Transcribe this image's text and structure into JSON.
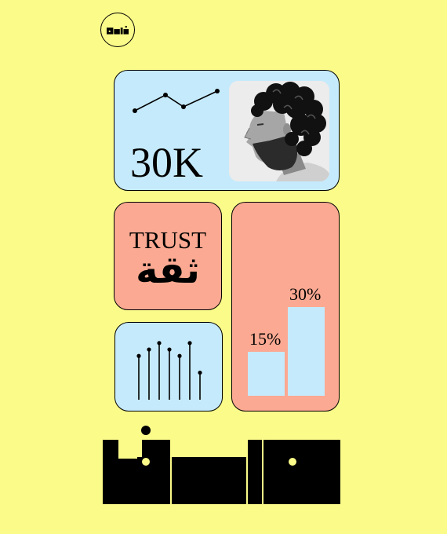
{
  "logo": {
    "icon": "wordmark-logo-icon"
  },
  "stat_card": {
    "value": "30K",
    "sparkline_icon": "line-chart-icon",
    "photo": "portrait-photo"
  },
  "trust_card": {
    "label_en": "TRUST",
    "label_ar": "ثقة"
  },
  "lollipop_card": {
    "icon": "lollipop-chart-icon",
    "values": [
      0.68,
      0.78,
      0.88,
      0.78,
      0.68,
      0.88,
      0.42
    ]
  },
  "bar_card": {
    "chart_data": {
      "type": "bar",
      "categories": [
        "",
        ""
      ],
      "values": [
        15,
        30
      ],
      "labels": [
        "15%",
        "30%"
      ],
      "ylim": [
        0,
        30
      ]
    }
  },
  "wordmark": {
    "icon": "large-wordmark-logo"
  },
  "colors": {
    "background": "#fbfb8a",
    "card_blue": "#c5eafb",
    "card_coral": "#fba992",
    "ink": "#000000"
  }
}
